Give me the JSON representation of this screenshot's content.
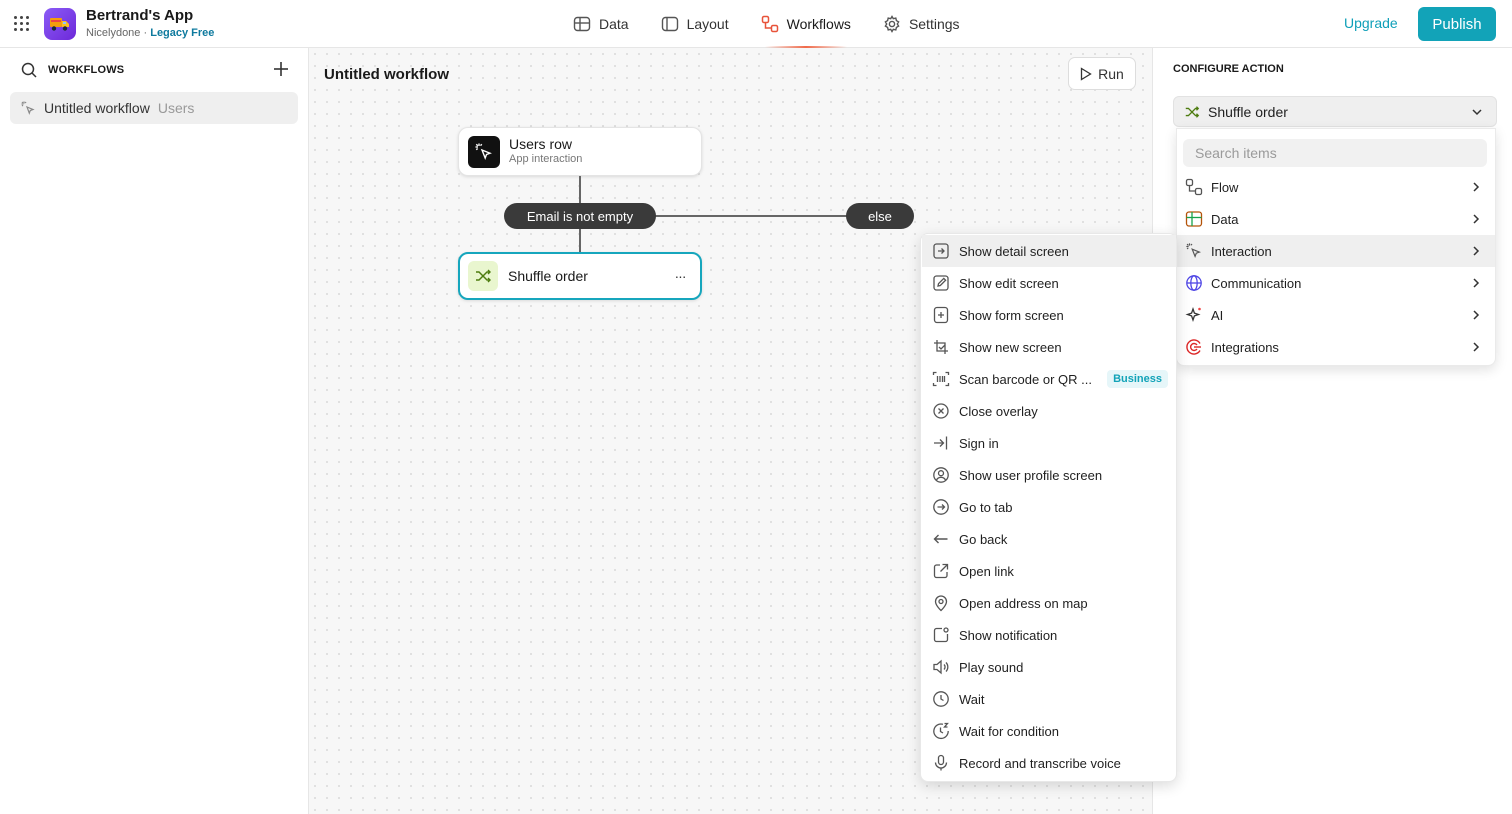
{
  "app": {
    "name": "Bertrand's App",
    "org": "Nicelydone",
    "separator": "·",
    "plan": "Legacy Free"
  },
  "nav": {
    "data": "Data",
    "layout": "Layout",
    "workflows": "Workflows",
    "settings": "Settings"
  },
  "header": {
    "upgrade": "Upgrade",
    "publish": "Publish"
  },
  "sidebar": {
    "title": "WORKFLOWS",
    "items": [
      {
        "label": "Untitled workflow",
        "sub": "Users"
      }
    ]
  },
  "canvas": {
    "title": "Untitled workflow",
    "run_label": "Run",
    "trigger": {
      "title": "Users row",
      "subtitle": "App interaction"
    },
    "condition": "Email is not empty",
    "else_label": "else",
    "action": {
      "title": "Shuffle order",
      "menu": "···"
    }
  },
  "config": {
    "title": "CONFIGURE ACTION",
    "selected": "Shuffle order",
    "search_placeholder": "Search items",
    "categories": [
      "Flow",
      "Data",
      "Interaction",
      "Communication",
      "AI",
      "Integrations"
    ]
  },
  "submenu": {
    "items": [
      "Show detail screen",
      "Show edit screen",
      "Show form screen",
      "Show new screen",
      "Scan barcode or QR ...",
      "Close overlay",
      "Sign in",
      "Show user profile screen",
      "Go to tab",
      "Go back",
      "Open link",
      "Open address on map",
      "Show notification",
      "Play sound",
      "Wait",
      "Wait for condition",
      "Record and transcribe voice"
    ],
    "badge": "Business"
  },
  "colors": {
    "accent": "#12a3b8",
    "workflow_icon": "#e8533a",
    "app_icon": "#7c3aed",
    "node_border": "#16a6bd"
  }
}
